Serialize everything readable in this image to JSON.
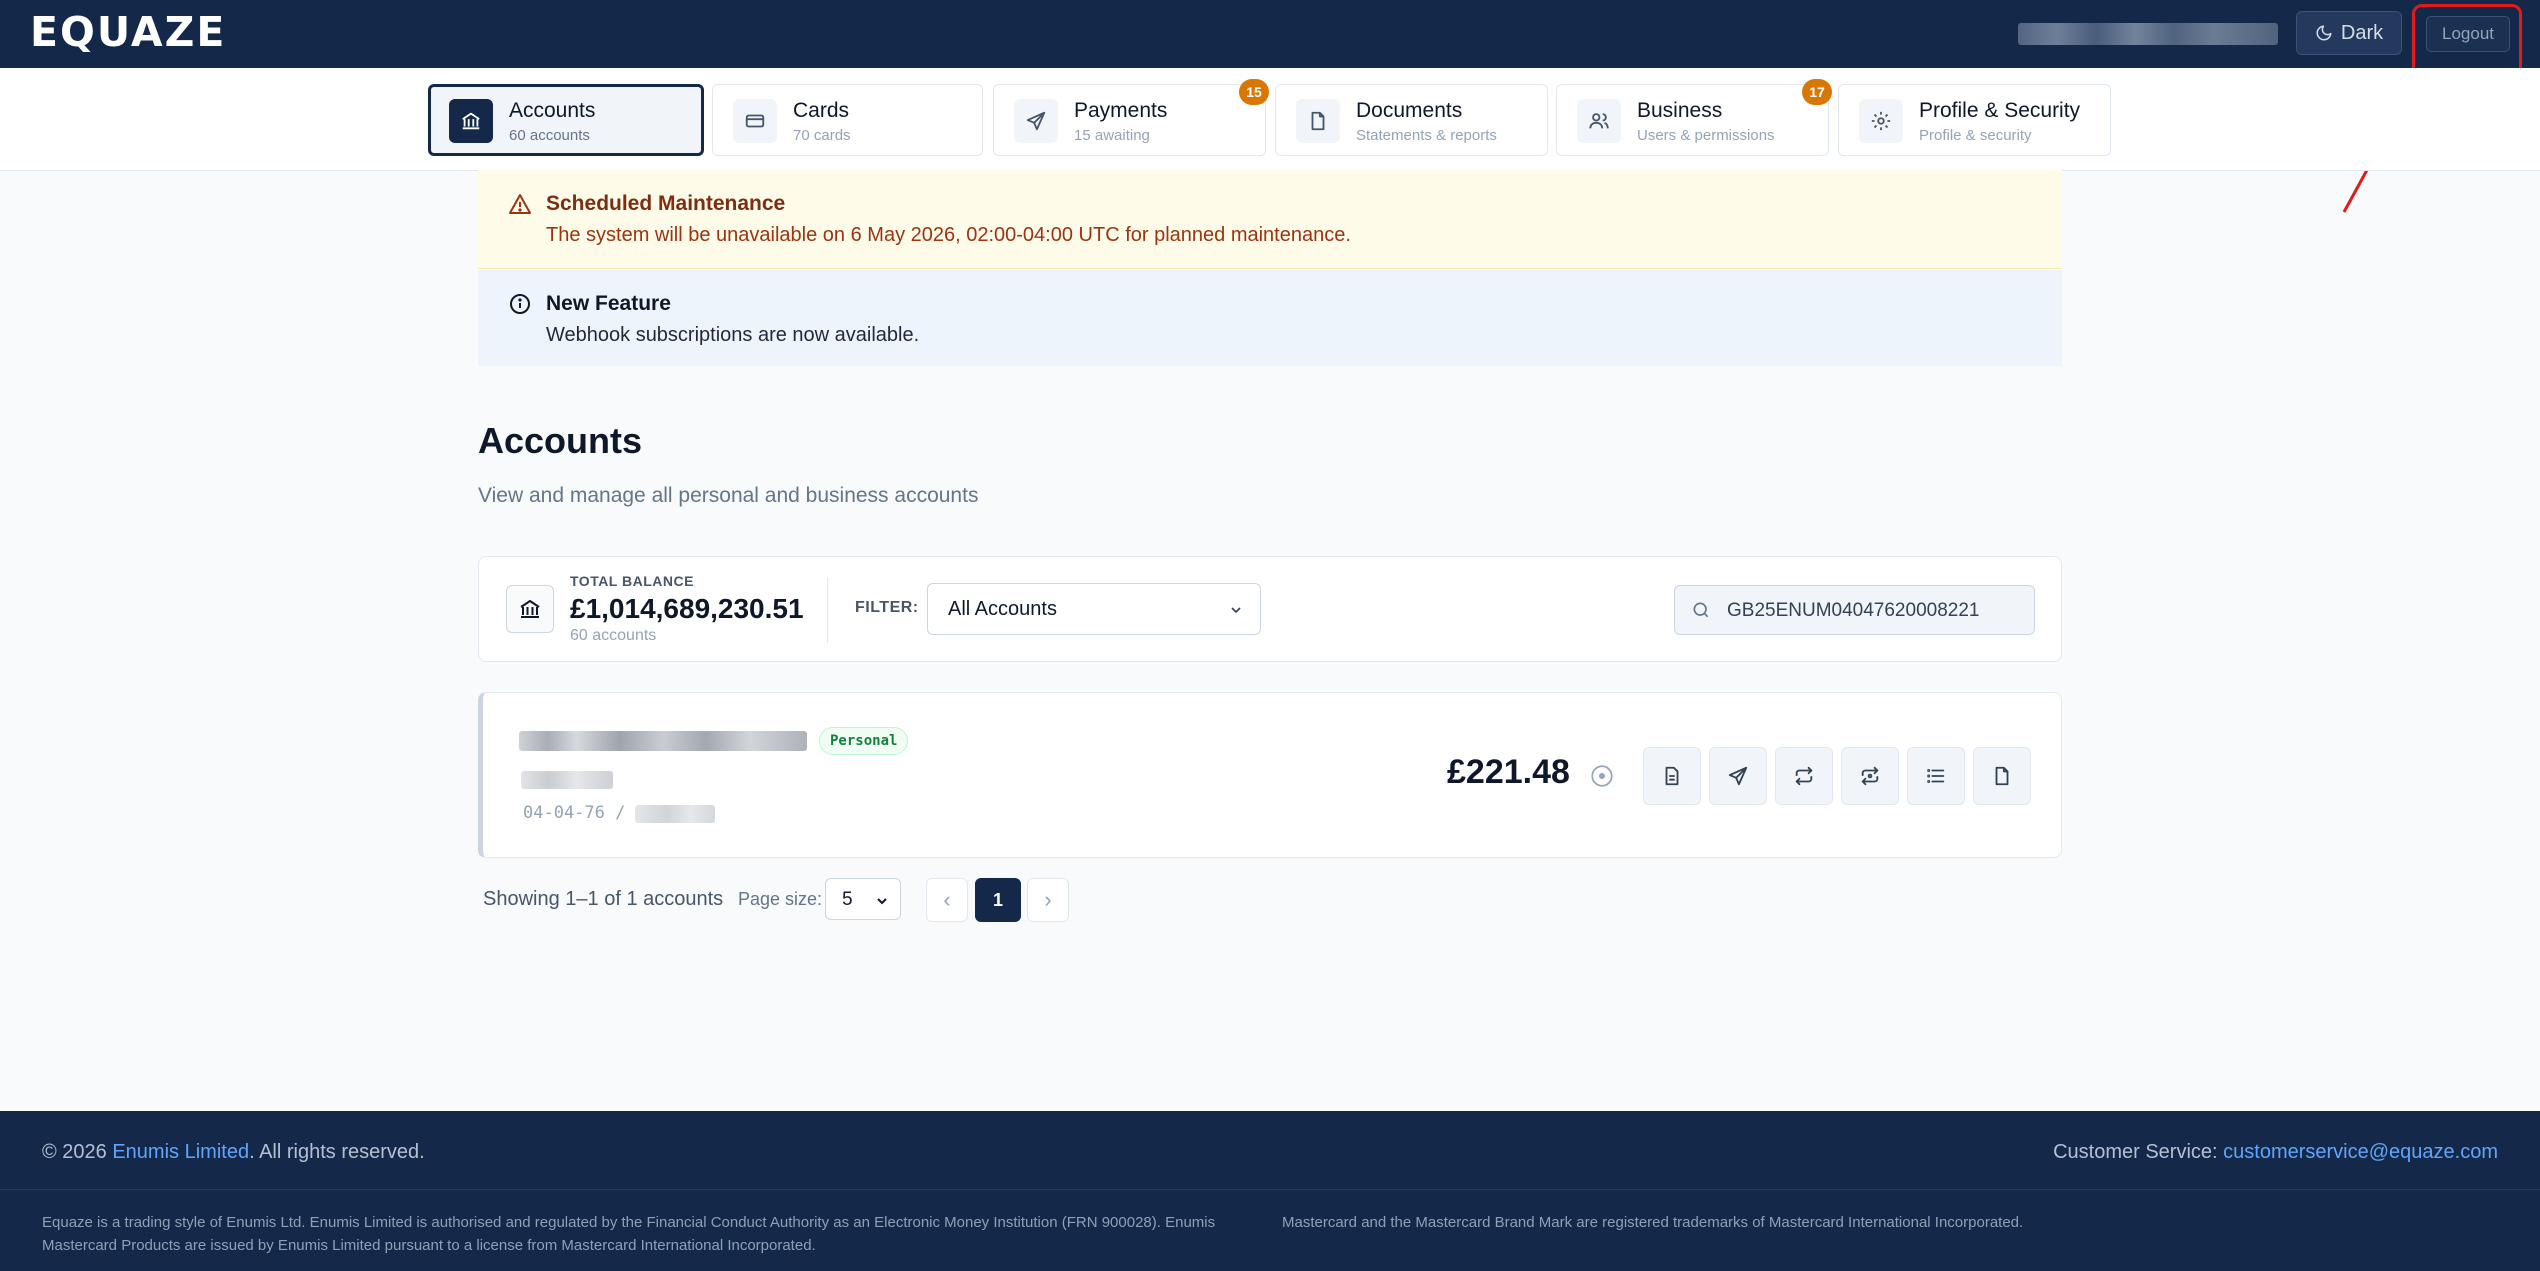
{
  "brand": {
    "logo_text": "EQUAZE"
  },
  "topbar": {
    "dark_label": "Dark",
    "logout_label": "Logout"
  },
  "nav": {
    "tabs": [
      {
        "label": "Accounts",
        "sub": "60 accounts",
        "icon": "bank-icon",
        "active": true
      },
      {
        "label": "Cards",
        "sub": "70 cards",
        "icon": "card-icon"
      },
      {
        "label": "Payments",
        "sub": "15 awaiting",
        "icon": "send-icon",
        "badge": "15"
      },
      {
        "label": "Documents",
        "sub": "Statements & reports",
        "icon": "document-icon"
      },
      {
        "label": "Business",
        "sub": "Users & permissions",
        "icon": "users-icon",
        "badge": "17"
      },
      {
        "label": "Profile & Security",
        "sub": "Profile & security",
        "icon": "gear-icon"
      }
    ]
  },
  "alerts": {
    "maintenance": {
      "title": "Scheduled Maintenance",
      "text": "The system will be unavailable on 6 May 2026, 02:00-04:00 UTC for planned maintenance."
    },
    "feature": {
      "title": "New Feature",
      "text": "Webhook subscriptions are now available."
    }
  },
  "page": {
    "title": "Accounts",
    "subtitle": "View and manage all personal and business accounts"
  },
  "summary": {
    "label": "TOTAL BALANCE",
    "amount": "£1,014,689,230.51",
    "count": "60 accounts",
    "filter_label": "FILTER:",
    "filter_value": "All Accounts",
    "search_value": "GB25ENUM04047620008221"
  },
  "account": {
    "type_badge": "Personal",
    "sort_code": "04-04-76  /",
    "balance": "£221.48",
    "actions": [
      "statement-icon",
      "send-icon",
      "transfer-icon",
      "exchange-icon",
      "list-icon",
      "file-icon"
    ]
  },
  "pagination": {
    "showing": "Showing 1–1 of 1 accounts",
    "page_size_label": "Page size:",
    "page_size": "5",
    "current_page": "1",
    "prev": "‹",
    "next": "›"
  },
  "footer": {
    "copyright_prefix": "© 2026 ",
    "company_link": "Enumis Limited",
    "copyright_suffix": ". All rights reserved.",
    "cs_label": "Customer Service: ",
    "cs_email": "customerservice@equaze.com",
    "legal_left": "Equaze is a trading style of Enumis Ltd. Enumis Limited is authorised and regulated by the Financial Conduct Authority as an Electronic Money Institution (FRN 900028). Enumis Mastercard Products are issued by Enumis Limited pursuant to a license from Mastercard International Incorporated.",
    "legal_right": "Mastercard and the Mastercard Brand Mark are registered trademarks of Mastercard International Incorporated."
  },
  "colors": {
    "navy": "#14294a",
    "badge_orange": "#d97706",
    "highlight_red": "#e01b1b",
    "link_blue": "#60a5fa"
  }
}
